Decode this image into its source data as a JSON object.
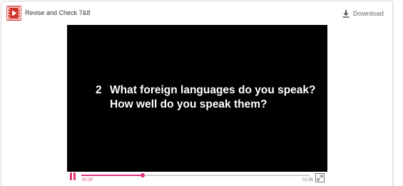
{
  "header": {
    "app_icon": "video-file-icon",
    "title": "Revise and Check 7&8",
    "download_icon": "download-icon",
    "download_label": "Download"
  },
  "video": {
    "caption_number": "2",
    "caption_line1": "What foreign languages do you speak?",
    "caption_line2": "How well do you speak them?"
  },
  "player": {
    "current_time": "00:30",
    "total_time": "01:56",
    "progress": 0.27,
    "state": "playing",
    "pause_icon": "pause-icon",
    "fullscreen_icon": "fullscreen-icon"
  },
  "colors": {
    "accent": "#e0317b",
    "brand_icon": "#d0342c",
    "video_bg": "#000000"
  }
}
